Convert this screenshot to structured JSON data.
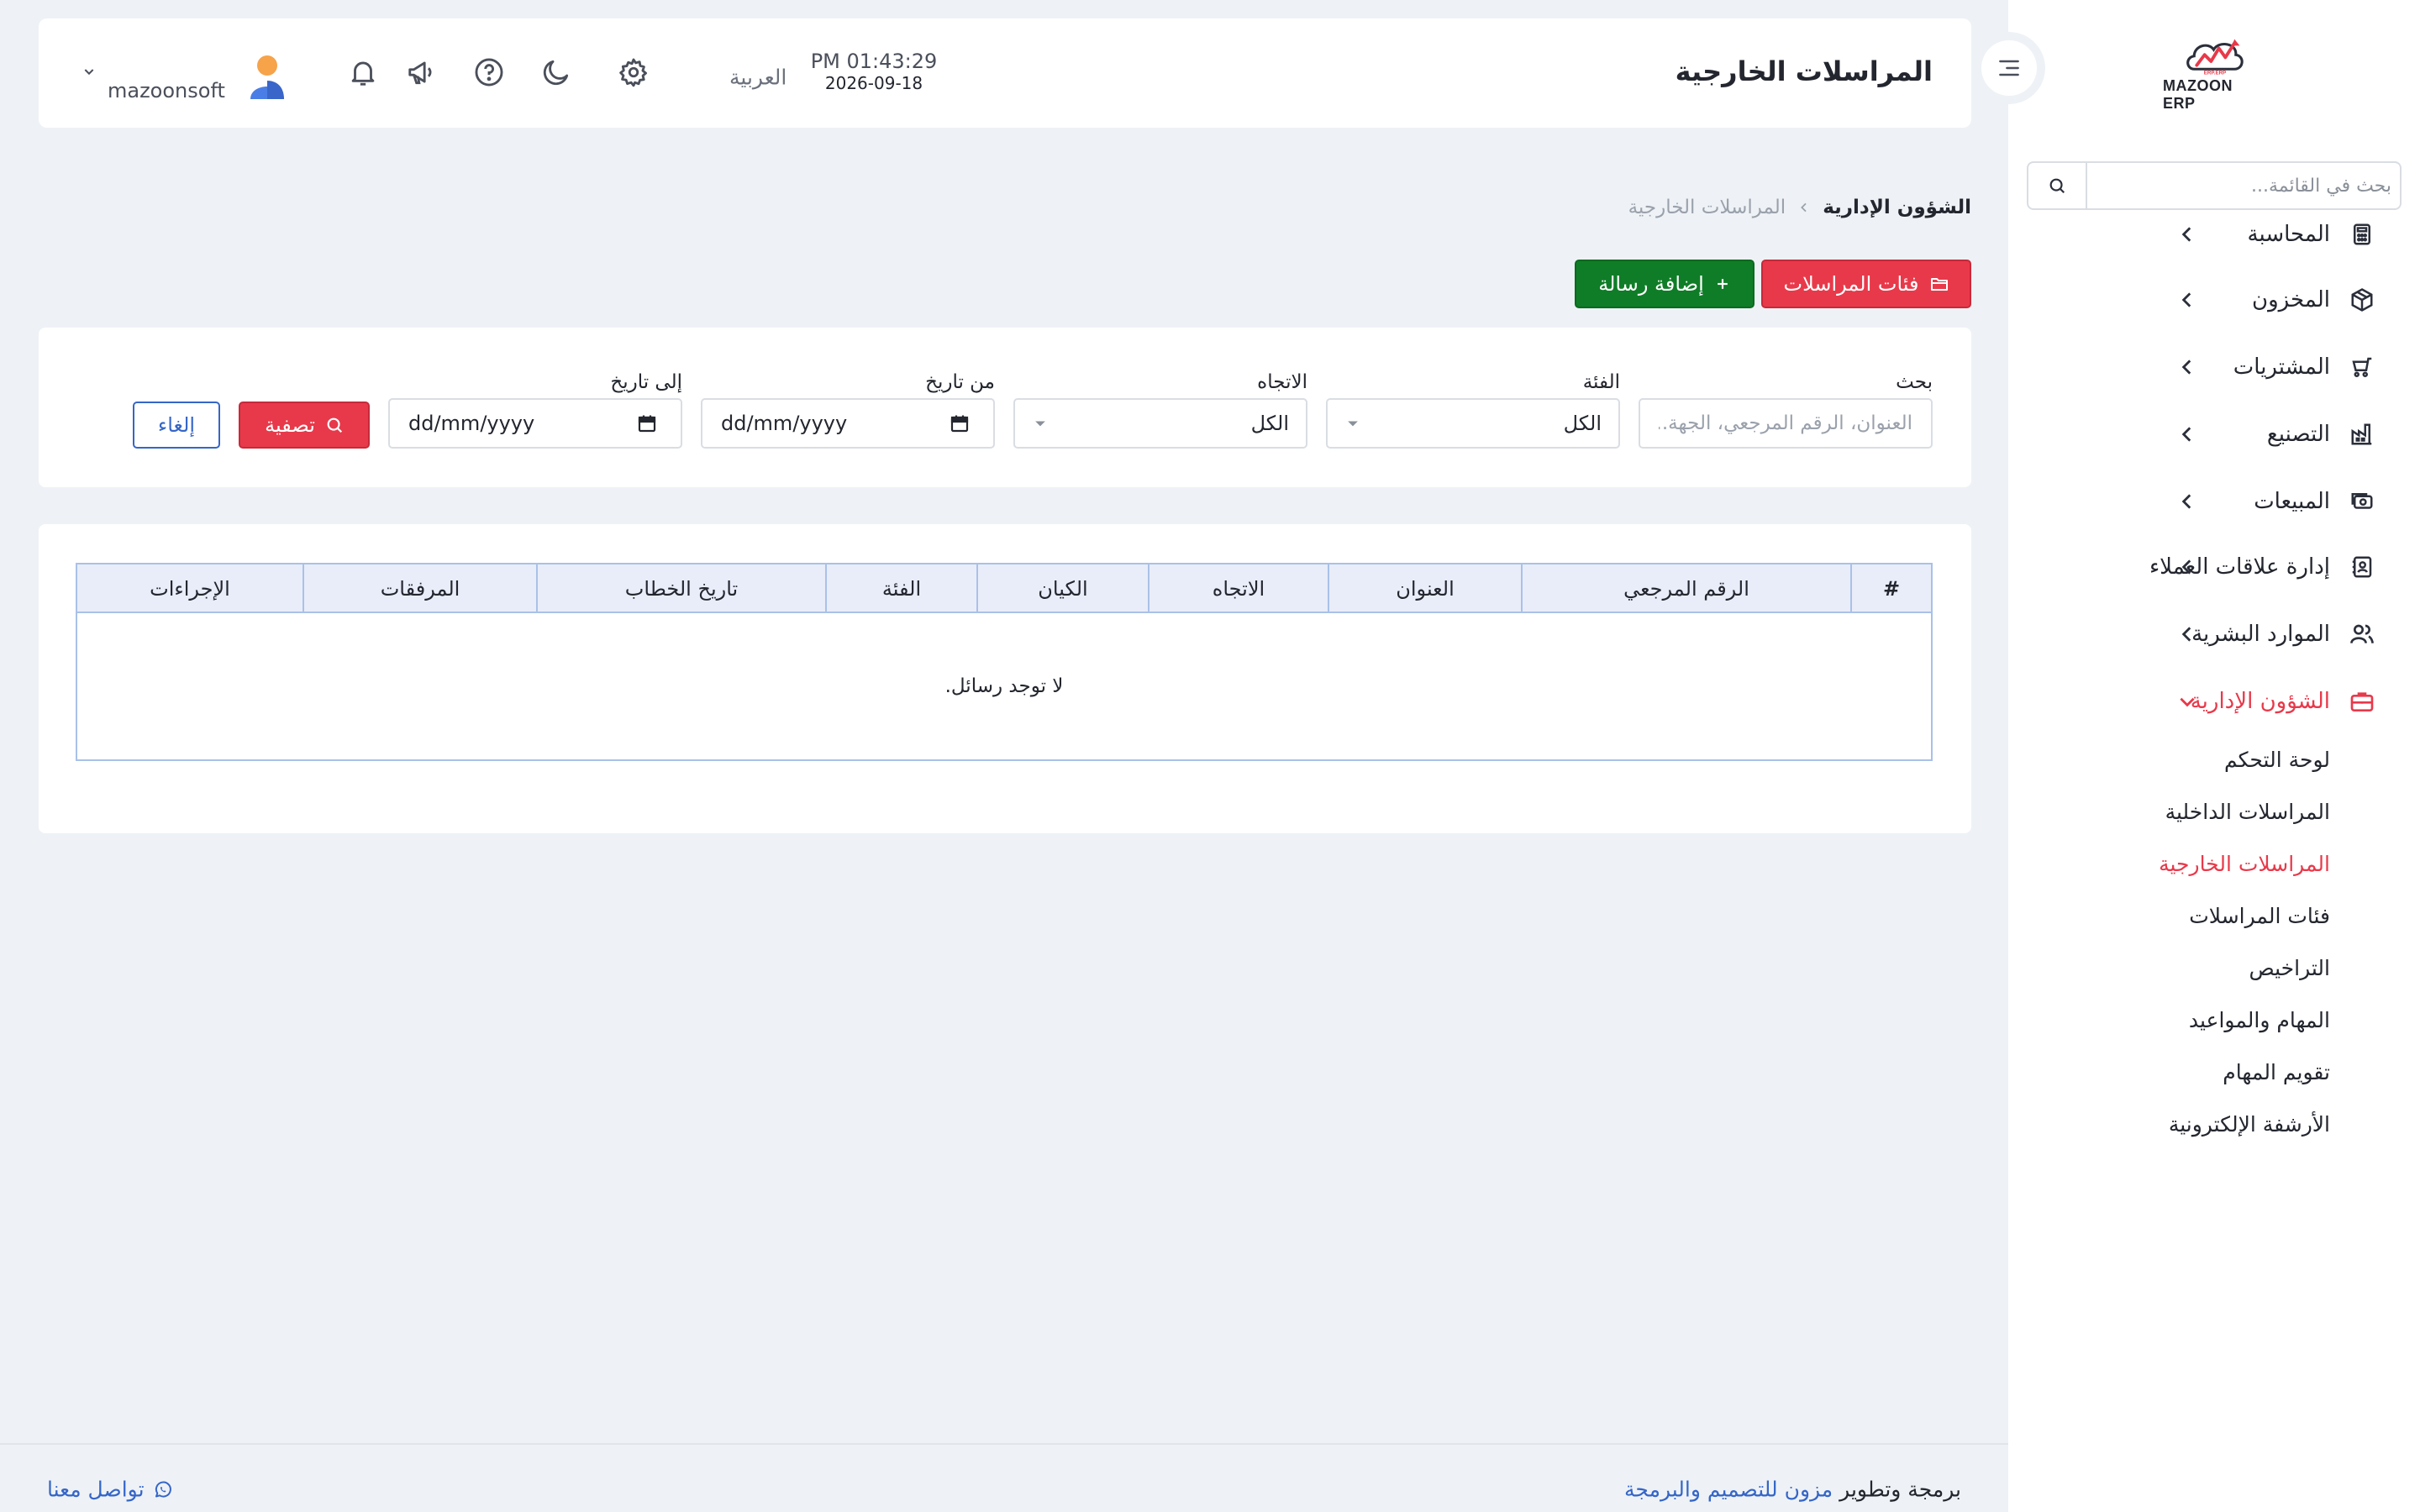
{
  "app": {
    "logo_text": "MAZOON ERP",
    "logo_small": "ERP.ERP"
  },
  "colors": {
    "accent_red": "#e8394a",
    "accent_green": "#0f7d27",
    "link_blue": "#3566c8",
    "page_bg": "#eef2f6"
  },
  "sidebar": {
    "search_placeholder": "بحث في القائمة...",
    "items": [
      {
        "label": "المحاسبة",
        "icon": "calculator-icon"
      },
      {
        "label": "المخزون",
        "icon": "box-icon"
      },
      {
        "label": "المشتريات",
        "icon": "cart-icon"
      },
      {
        "label": "التصنيع",
        "icon": "factory-icon"
      },
      {
        "label": "المبيعات",
        "icon": "cash-icon"
      },
      {
        "label": "إدارة علاقات العملاء",
        "icon": "contacts-icon"
      },
      {
        "label": "الموارد البشرية",
        "icon": "users-icon"
      },
      {
        "label": "الشؤون الإدارية",
        "icon": "briefcase-icon"
      }
    ],
    "sub_items": [
      "لوحة التحكم",
      "المراسلات الداخلية",
      "المراسلات الخارجية",
      "فئات المراسلات",
      "التراخيص",
      "المهام والمواعيد",
      "تقويم المهام",
      "الأرشفة الإلكترونية"
    ]
  },
  "header": {
    "title": "المراسلات الخارجية",
    "time": "PM 01:43:29",
    "date": "2026-09-18",
    "language": "العربية",
    "username": "mazoonsoft"
  },
  "breadcrumb": {
    "parent": "الشؤون الإدارية",
    "current": "المراسلات الخارجية"
  },
  "actions": {
    "categories_button": "فئات المراسلات",
    "add_button": "إضافة رسالة"
  },
  "filters": {
    "search_label": "بحث",
    "search_placeholder": "العنوان، الرقم المرجعي، الجهة...",
    "category_label": "الفئة",
    "category_value": "الكل",
    "direction_label": "الاتجاه",
    "direction_value": "الكل",
    "from_label": "من تاريخ",
    "from_placeholder": "dd/mm/yyyy",
    "to_label": "إلى تاريخ",
    "to_placeholder": "dd/mm/yyyy",
    "filter_button": "تصفية",
    "cancel_button": "إلغاء"
  },
  "table": {
    "columns": [
      "#",
      "الرقم المرجعي",
      "العنوان",
      "الاتجاه",
      "الكيان",
      "الفئة",
      "تاريخ الخطاب",
      "المرفقات",
      "الإجراءات"
    ],
    "empty_message": "لا توجد رسائل."
  },
  "footer": {
    "credit_prefix": "برمجة وتطوير",
    "credit_link": "مزون للتصميم والبرمجة",
    "contact": "تواصل معنا"
  }
}
